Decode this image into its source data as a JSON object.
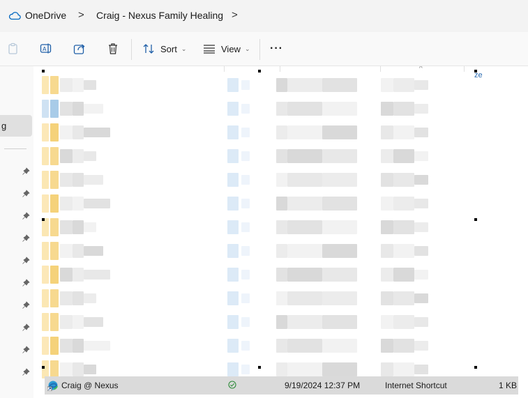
{
  "breadcrumb": {
    "items": [
      {
        "label": "OneDrive"
      },
      {
        "label": "Craig - Nexus Family Healing"
      }
    ],
    "separator": ">"
  },
  "toolbar": {
    "sort_label": "Sort",
    "view_label": "View",
    "more_label": "···",
    "icons": [
      "paste-icon",
      "rename-icon",
      "share-icon",
      "delete-icon",
      "sort-icon",
      "view-icon"
    ]
  },
  "nav": {
    "selected_label": "g",
    "pinned_count": 10
  },
  "header": {
    "size_partial": "ze"
  },
  "selected_row": {
    "name": "Craig @ Nexus",
    "status_icon": "synced-check-icon",
    "date_modified": "9/19/2024 12:37 PM",
    "type": "Internet Shortcut",
    "size": "1 KB"
  },
  "colors": {
    "accent": "#0067c0",
    "selected_row": "#dadada",
    "folder": "#ffd97a",
    "synced": "#2e8b3a"
  }
}
